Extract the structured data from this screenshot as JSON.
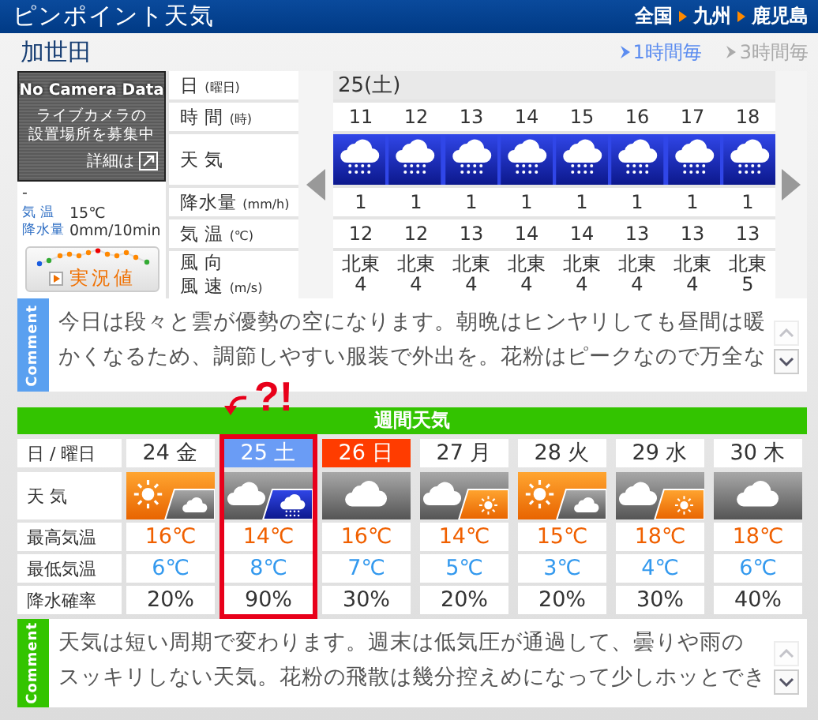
{
  "header": {
    "title": "ピンポイント天気",
    "breadcrumb": [
      "全国",
      "九州",
      "鹿児島"
    ]
  },
  "location": "加世田",
  "interval_tabs": [
    {
      "label": "1時間毎",
      "selected": true
    },
    {
      "label": "3時間毎",
      "selected": false
    }
  ],
  "camera": {
    "heading": "No Camera Data",
    "message_lines": [
      "ライブカメラの",
      "設置場所を募集中"
    ],
    "link": "詳細は"
  },
  "observation": {
    "time": "-",
    "rows": [
      {
        "label": "気 温",
        "value": "15℃"
      },
      {
        "label": "降水量",
        "value": "0mm/10min"
      }
    ],
    "button": "実況値"
  },
  "hourly": {
    "labels": [
      {
        "lines": [
          "日"
        ],
        "unit": "(曜日)"
      },
      {
        "lines": [
          "時 間"
        ],
        "unit": "(時)"
      },
      {
        "lines": [
          "天 気"
        ]
      },
      {
        "lines": [
          "降水量"
        ],
        "unit": "(mm/h)"
      },
      {
        "lines": [
          "気 温"
        ],
        "unit": "(℃)"
      },
      {
        "lines": [
          "風 向",
          "風 速"
        ],
        "unit": "(m/s)"
      }
    ],
    "date": "25(土)",
    "hours": [
      {
        "hour": "11",
        "weather": {
          "kind": "rain"
        },
        "precip": "1",
        "temp": "12",
        "wind_dir": "北東",
        "wind_speed": "4"
      },
      {
        "hour": "12",
        "weather": {
          "kind": "rain"
        },
        "precip": "1",
        "temp": "12",
        "wind_dir": "北東",
        "wind_speed": "4"
      },
      {
        "hour": "13",
        "weather": {
          "kind": "rain"
        },
        "precip": "1",
        "temp": "13",
        "wind_dir": "北東",
        "wind_speed": "4"
      },
      {
        "hour": "14",
        "weather": {
          "kind": "rain"
        },
        "precip": "1",
        "temp": "14",
        "wind_dir": "北東",
        "wind_speed": "4"
      },
      {
        "hour": "15",
        "weather": {
          "kind": "rain"
        },
        "precip": "1",
        "temp": "14",
        "wind_dir": "北東",
        "wind_speed": "4"
      },
      {
        "hour": "16",
        "weather": {
          "kind": "rain"
        },
        "precip": "1",
        "temp": "13",
        "wind_dir": "北東",
        "wind_speed": "4"
      },
      {
        "hour": "17",
        "weather": {
          "kind": "rain"
        },
        "precip": "1",
        "temp": "13",
        "wind_dir": "北東",
        "wind_speed": "4"
      },
      {
        "hour": "18",
        "weather": {
          "kind": "rain"
        },
        "precip": "1",
        "temp": "13",
        "wind_dir": "北東",
        "wind_speed": "5"
      }
    ]
  },
  "comments": [
    {
      "label": "Comment",
      "color": "#5aa0f0",
      "lines": [
        "今日は段々と雲が優勢の空になります。朝晩はヒンヤリしても昼間は暖",
        "かくなるため、調節しやすい服装で外出を。花粉はピークなので万全な"
      ],
      "scroll_up_disabled": true
    },
    {
      "label": "Comment",
      "color": "#33c400",
      "lines": [
        "天気は短い周期で変わります。週末は低気圧が通過して、曇りや雨の",
        "スッキリしない天気。花粉の飛散は幾分控えめになって少しホッとでき"
      ],
      "scroll_up_disabled": true
    }
  ],
  "weekly": {
    "title": "週間天気",
    "annotation": "?!",
    "labels": [
      "日 / 曜日",
      "天 気",
      "最高気温",
      "最低気温",
      "降水確率"
    ],
    "days": [
      {
        "date": "24 金",
        "kind": "weekday",
        "weather": [
          {
            "kind": "sun"
          },
          {
            "kind": "cloud"
          }
        ],
        "high": "16℃",
        "low": "6℃",
        "precip": "20%",
        "highlighted": false
      },
      {
        "date": "25 土",
        "kind": "saturday",
        "weather": [
          {
            "kind": "cloud"
          },
          {
            "kind": "rain"
          }
        ],
        "high": "14℃",
        "low": "8℃",
        "precip": "90%",
        "highlighted": true
      },
      {
        "date": "26 日",
        "kind": "sunday",
        "weather": [
          {
            "kind": "cloud"
          }
        ],
        "high": "16℃",
        "low": "7℃",
        "precip": "30%",
        "highlighted": false
      },
      {
        "date": "27 月",
        "kind": "weekday",
        "weather": [
          {
            "kind": "cloud"
          },
          {
            "kind": "sun"
          }
        ],
        "high": "14℃",
        "low": "5℃",
        "precip": "20%",
        "highlighted": false
      },
      {
        "date": "28 火",
        "kind": "weekday",
        "weather": [
          {
            "kind": "sun"
          },
          {
            "kind": "cloud"
          }
        ],
        "high": "15℃",
        "low": "3℃",
        "precip": "20%",
        "highlighted": false
      },
      {
        "date": "29 水",
        "kind": "weekday",
        "weather": [
          {
            "kind": "cloud"
          },
          {
            "kind": "sun"
          }
        ],
        "high": "18℃",
        "low": "4℃",
        "precip": "30%",
        "highlighted": false
      },
      {
        "date": "30 木",
        "kind": "weekday",
        "weather": [
          {
            "kind": "cloud"
          }
        ],
        "high": "18℃",
        "low": "6℃",
        "precip": "40%",
        "highlighted": false
      }
    ]
  }
}
